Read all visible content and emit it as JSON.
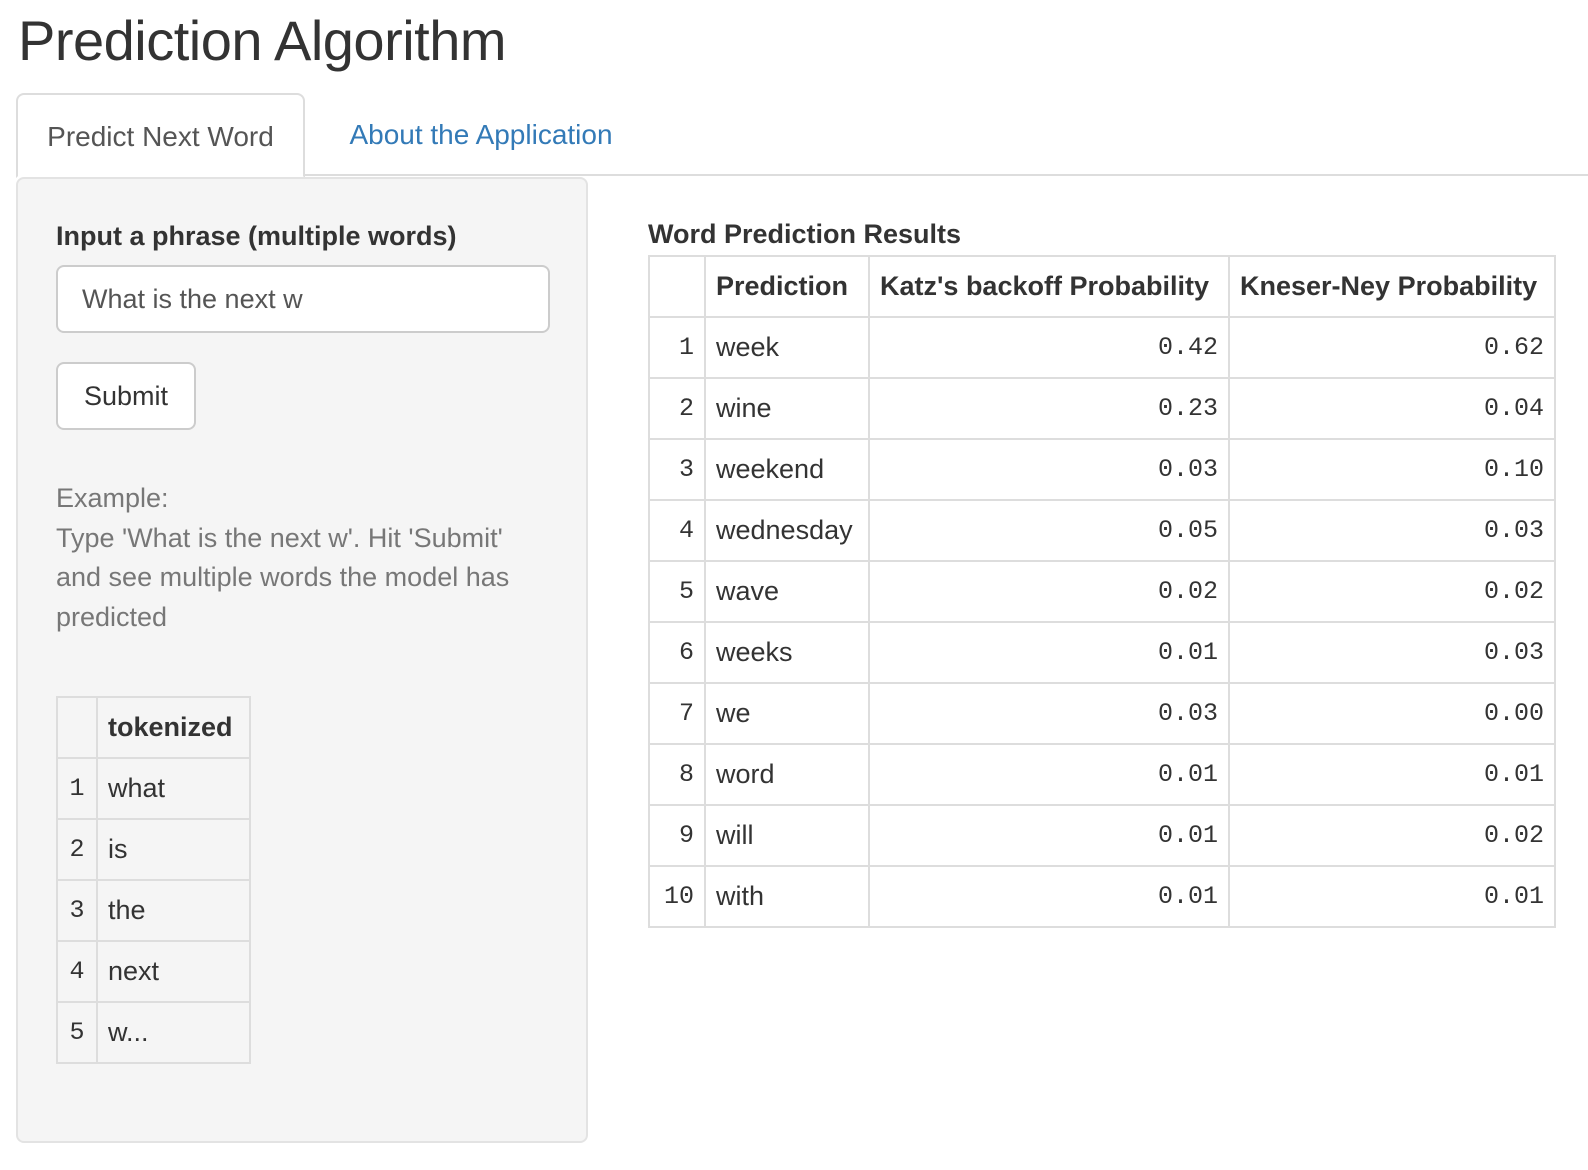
{
  "app": {
    "title": "Prediction Algorithm"
  },
  "tabs": [
    {
      "label": "Predict Next Word",
      "active": true
    },
    {
      "label": "About the Application",
      "active": false
    }
  ],
  "sidebar": {
    "input_label": "Input a phrase (multiple words)",
    "input_value": "What is the next w",
    "submit_label": "Submit",
    "example_heading": "Example:",
    "example_body": "Type 'What is the next w'. Hit 'Submit' and see multiple words the model has predicted",
    "tokens": {
      "header": "tokenized",
      "rows": [
        {
          "index": "1",
          "token": "what"
        },
        {
          "index": "2",
          "token": "is"
        },
        {
          "index": "3",
          "token": "the"
        },
        {
          "index": "4",
          "token": "next"
        },
        {
          "index": "5",
          "token": "w..."
        }
      ]
    }
  },
  "results": {
    "title": "Word Prediction Results",
    "columns": [
      "",
      "Prediction",
      "Katz's backoff Probability",
      "Kneser-Ney Probability"
    ],
    "rows": [
      {
        "index": "1",
        "word": "week",
        "katz": "0.42",
        "kn": "0.62"
      },
      {
        "index": "2",
        "word": "wine",
        "katz": "0.23",
        "kn": "0.04"
      },
      {
        "index": "3",
        "word": "weekend",
        "katz": "0.03",
        "kn": "0.10"
      },
      {
        "index": "4",
        "word": "wednesday",
        "katz": "0.05",
        "kn": "0.03"
      },
      {
        "index": "5",
        "word": "wave",
        "katz": "0.02",
        "kn": "0.02"
      },
      {
        "index": "6",
        "word": "weeks",
        "katz": "0.01",
        "kn": "0.03"
      },
      {
        "index": "7",
        "word": "we",
        "katz": "0.03",
        "kn": "0.00"
      },
      {
        "index": "8",
        "word": "word",
        "katz": "0.01",
        "kn": "0.01"
      },
      {
        "index": "9",
        "word": "will",
        "katz": "0.01",
        "kn": "0.02"
      },
      {
        "index": "10",
        "word": "with",
        "katz": "0.01",
        "kn": "0.01"
      }
    ]
  },
  "colors": {
    "link": "#337ab7",
    "well_bg": "#f5f5f5",
    "border": "#dddddd",
    "muted_text": "#777777"
  }
}
